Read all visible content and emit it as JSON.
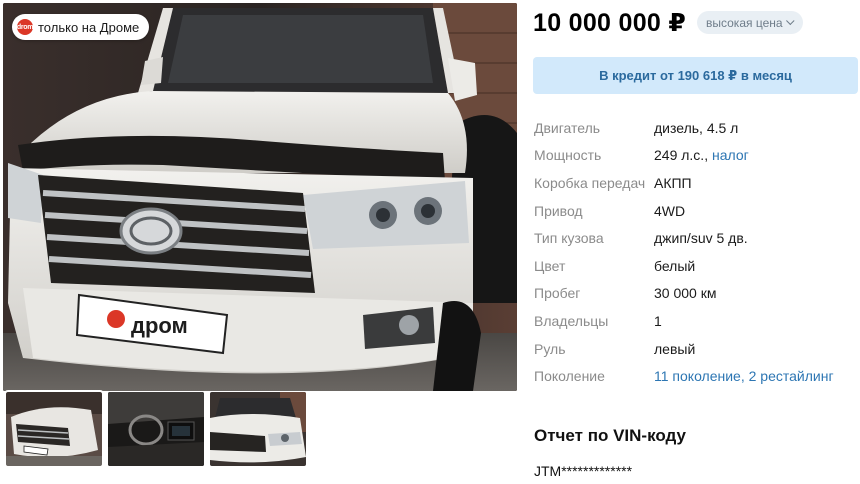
{
  "gallery": {
    "badge_label": "только на Дроме",
    "badge_logo_text": "drom",
    "plate_text": "дром",
    "thumbnails": [
      {
        "alt": "front-view"
      },
      {
        "alt": "interior-view"
      },
      {
        "alt": "front-side-view"
      }
    ]
  },
  "offer": {
    "price": "10 000 000 ₽",
    "price_rating": "высокая цена",
    "credit_label": "В кредит от 190 618 ₽ в месяц"
  },
  "specs": [
    {
      "label": "Двигатель",
      "value": "дизель, 4.5 л"
    },
    {
      "label": "Мощность",
      "value": "249 л.с.,",
      "link": "налог"
    },
    {
      "label": "Коробка передач",
      "value": "АКПП"
    },
    {
      "label": "Привод",
      "value": "4WD"
    },
    {
      "label": "Тип кузова",
      "value": "джип/suv 5 дв."
    },
    {
      "label": "Цвет",
      "value": "белый"
    },
    {
      "label": "Пробег",
      "value": "30 000 км"
    },
    {
      "label": "Владельцы",
      "value": "1"
    },
    {
      "label": "Руль",
      "value": "левый"
    },
    {
      "label": "Поколение",
      "link": "11 поколение, 2 рестайлинг"
    }
  ],
  "vin": {
    "title": "Отчет по VIN-коду",
    "value": "JTM*************"
  },
  "colors": {
    "accent_link": "#2d76b3",
    "credit_bg": "#d2e9fb",
    "brand_red": "#db3727"
  }
}
